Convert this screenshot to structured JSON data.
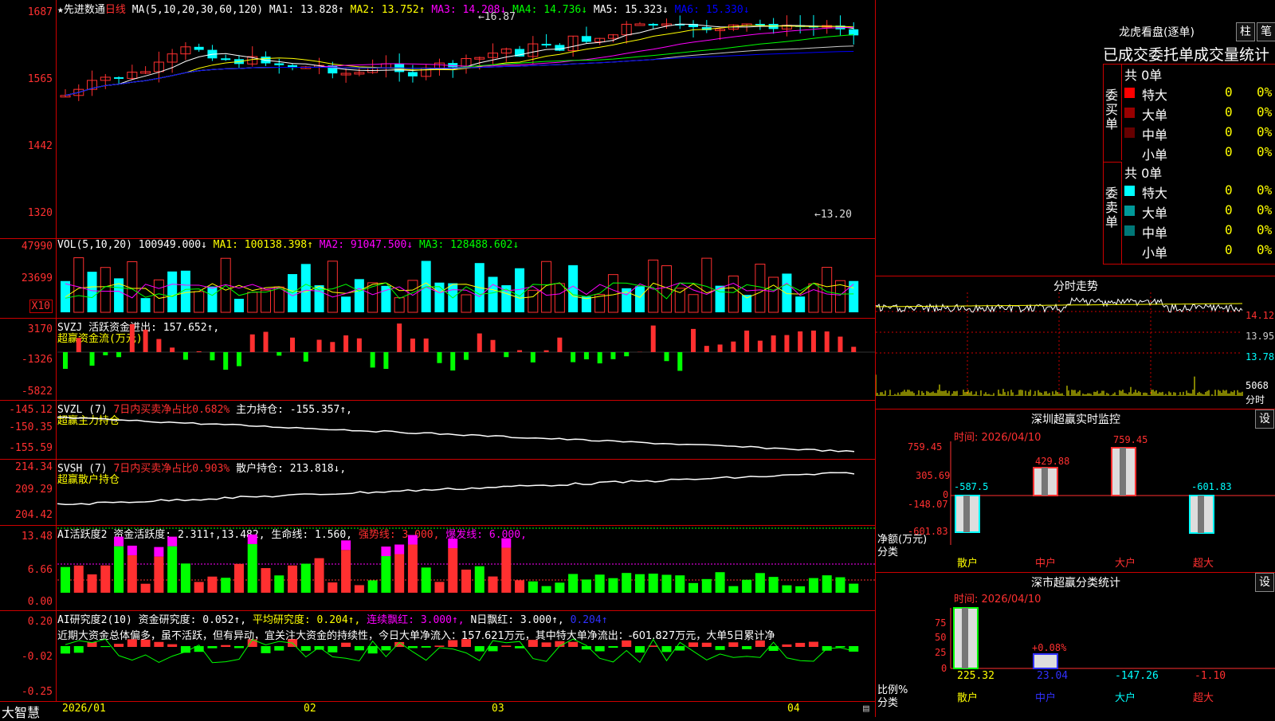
{
  "stock": {
    "prefix": "★",
    "name": "先进数通",
    "period": "日线"
  },
  "main_chart": {
    "ma_label": "MA(5,10,20,30,60,120)",
    "ma1": "MA1: 13.828↑",
    "ma2": "MA2: 13.752↑",
    "ma3": "MA3: 14.208↓",
    "ma4": "MA4: 14.736↓",
    "ma5": "MA5: 15.323↓",
    "ma6": "MA6: 15.330↓",
    "high_label": "16.87",
    "low_label": "13.20",
    "y_ticks": [
      "1687",
      "1565",
      "1442",
      "1320"
    ],
    "colors": {
      "ma1": "#ffffff",
      "ma2": "#ffff00",
      "ma3": "#ff00ff",
      "ma4": "#00ff00",
      "ma5": "#cccccc",
      "ma6": "#0000ff"
    }
  },
  "vol_chart": {
    "label": "VOL(5,10,20)",
    "value": "100949.000↓",
    "ma1": "MA1: 100138.398↑",
    "ma2": "MA2: 91047.500↓",
    "ma3": "MA3: 128488.602↓",
    "y_ticks": [
      "47990",
      "23699"
    ],
    "unit": "X10"
  },
  "svzj": {
    "label": "SVZJ  活跃资金进出: 157.652↑,",
    "sub": "超赢资金流(万元)",
    "y_ticks": [
      "3170",
      "-1326",
      "-5822"
    ]
  },
  "svzl": {
    "label": "SVZL (7)",
    "hl": "7日内买卖净占比0.682%",
    "rest": "主力持仓: -155.357↑,",
    "sub": "超赢主力持仓",
    "y_ticks": [
      "-145.12",
      "-150.35",
      "-155.59"
    ]
  },
  "svsh": {
    "label": "SVSH (7)",
    "hl": "7日内买卖净占比0.903%",
    "rest": "散户持仓: 213.818↓,",
    "sub": "超赢散户持仓",
    "y_ticks": [
      "214.34",
      "209.29",
      "204.42"
    ]
  },
  "ai_active": {
    "label": "AI活跃度2 资金活跃度: 2.311↑,13.482,",
    "life": "生命线: 1.560,",
    "strong": "强势线: 3.000,",
    "burst": "爆发线: 6.000,",
    "y_ticks": [
      "13.48",
      "6.66",
      "0.00"
    ]
  },
  "ai_research": {
    "label": "AI研究度2(10) 资金研究度: 0.052↑,",
    "avg": "平均研究度: 0.204↑,",
    "cont": "连续飘红: 3.000↑,",
    "nday": "N日飘红: 3.000↑,",
    "v": "0.204↑",
    "comment": "近期大资金总体偏多，虽不活跃，但有异动，宜关注大资金的持续性，今日大单净流入：157.621万元，其中特大单净流出：-601.827万元，大单5日累计净",
    "y_ticks": [
      "0.20",
      "-0.02",
      "-0.25"
    ]
  },
  "x_axis": {
    "labels": [
      "2026/01",
      "02",
      "03",
      "04"
    ]
  },
  "brand": "大智慧",
  "longhu": {
    "title": "龙虎看盘(逐单)",
    "btn1": "柱",
    "btn2": "笔",
    "header": "已成交委托单成交量统计",
    "buy_side": "委买单",
    "sell_side": "委卖单",
    "buy_total": "共 0单",
    "sell_total": "共 0单",
    "buy_rows": [
      {
        "name": "特大",
        "v": "0",
        "p": "0%",
        "c": "#ff0000"
      },
      {
        "name": "大单",
        "v": "0",
        "p": "0%",
        "c": "#990000"
      },
      {
        "name": "中单",
        "v": "0",
        "p": "0%",
        "c": "#660000"
      },
      {
        "name": "小单",
        "v": "0",
        "p": "0%",
        "c": ""
      }
    ],
    "sell_rows": [
      {
        "name": "特大",
        "v": "0",
        "p": "0%",
        "c": "#00ffff"
      },
      {
        "name": "大单",
        "v": "0",
        "p": "0%",
        "c": "#009999"
      },
      {
        "name": "中单",
        "v": "0",
        "p": "0%",
        "c": "#007777"
      },
      {
        "name": "小单",
        "v": "0",
        "p": "0%",
        "c": ""
      }
    ]
  },
  "minute": {
    "title": "分时走势",
    "y_ticks": [
      "14.12",
      "13.95",
      "13.78"
    ],
    "vol_tick": "5068",
    "unit": "分时"
  },
  "monitor": {
    "title": "深圳超赢实时监控",
    "btn": "设",
    "time": "时间: 2026/04/10",
    "y_ticks": [
      "759.45",
      "305.69",
      "0",
      "-148.07",
      "-601.83"
    ],
    "ylabel": "净额(万元)",
    "xlabel": "分类",
    "categories": [
      "散户",
      "中户",
      "大户",
      "超大"
    ],
    "bar_labels": [
      "-587.5",
      "429.88",
      "759.45",
      "-601.83"
    ]
  },
  "classify": {
    "title": "深市超赢分类统计",
    "btn": "设",
    "time": "时间: 2026/04/10",
    "y_ticks": [
      "75",
      "50",
      "25",
      "0"
    ],
    "ylabel": "比例%",
    "xlabel": "分类",
    "categories": [
      "散户",
      "中户",
      "大户",
      "超大"
    ],
    "values": [
      "225.32",
      "23.04",
      "-147.26",
      "-1.10"
    ],
    "mid_label": "+0.08%"
  }
}
